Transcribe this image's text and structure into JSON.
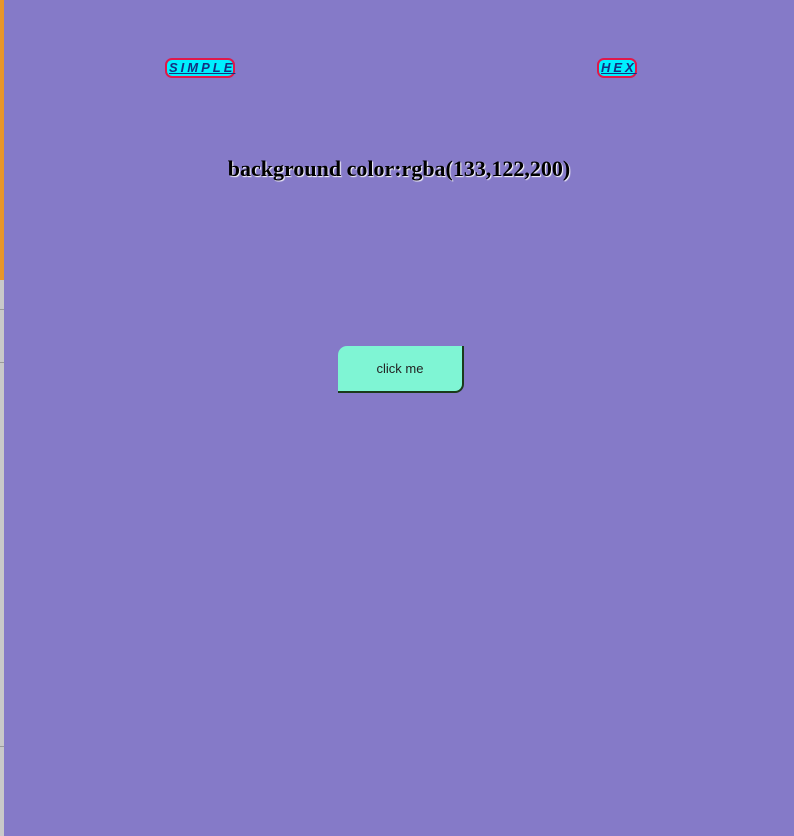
{
  "nav": {
    "simple_label": "SIMPLE",
    "hex_label": "HEX"
  },
  "main": {
    "background_label": "background color:rgba(133,122,200)",
    "button_label": "click me"
  },
  "colors": {
    "background": "#857AC8",
    "button": "#7FF5D4",
    "link_fill": "#00F0FF",
    "link_border": "#E0184A"
  }
}
